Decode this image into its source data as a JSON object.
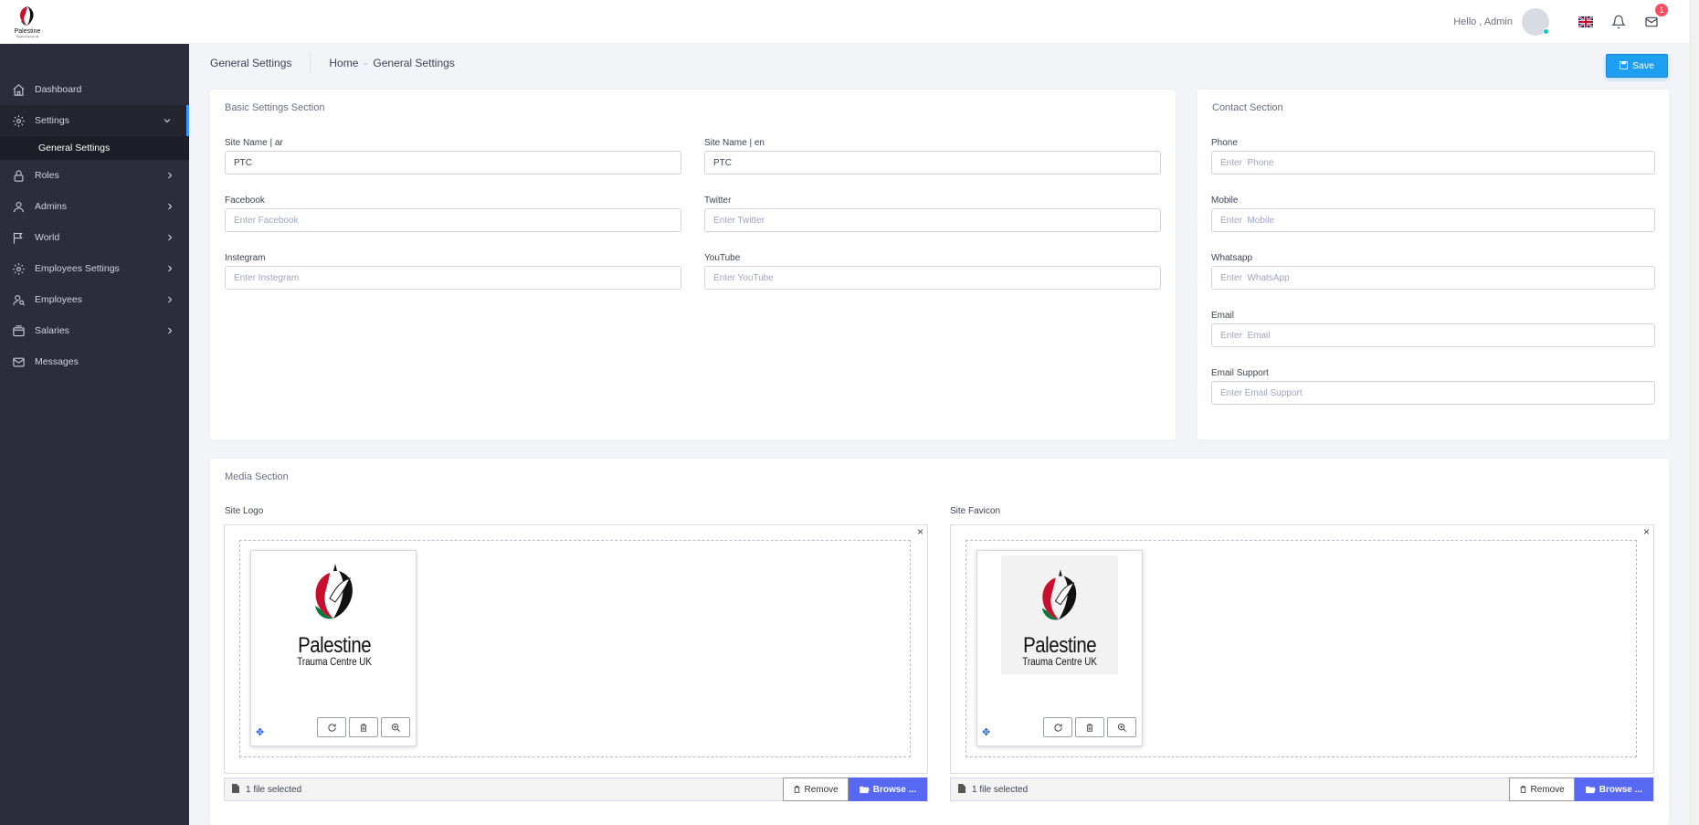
{
  "header": {
    "logo_text": "Palestine",
    "logo_sub": "Trauma Centre UK",
    "greeting": "Hello ,  Admin",
    "notifications_badge": "1"
  },
  "sidebar": {
    "items": [
      {
        "label": "Dashboard",
        "icon": "home-icon"
      },
      {
        "label": "Settings",
        "icon": "gear-icon"
      },
      {
        "label": "Roles",
        "icon": "lock-icon"
      },
      {
        "label": "Admins",
        "icon": "user-icon"
      },
      {
        "label": "World",
        "icon": "flag-icon"
      },
      {
        "label": "Employees Settings",
        "icon": "gear-icon"
      },
      {
        "label": "Employees",
        "icon": "users-icon"
      },
      {
        "label": "Salaries",
        "icon": "wallet-icon"
      },
      {
        "label": "Messages",
        "icon": "envelope-icon"
      }
    ],
    "sub_item": "General Settings"
  },
  "subheader": {
    "title": "General Settings",
    "crumb_home": "Home",
    "crumb_sep": "-",
    "crumb_current": "General Settings",
    "save_label": "Save"
  },
  "basic": {
    "title": "Basic Settings Section",
    "site_name_ar": {
      "label": "Site Name | ar",
      "value": "PTC",
      "placeholder": ""
    },
    "site_name_en": {
      "label": "Site Name | en",
      "value": "PTC",
      "placeholder": ""
    },
    "facebook": {
      "label": "Facebook",
      "value": "",
      "placeholder": "Enter Facebook"
    },
    "twitter": {
      "label": "Twitter",
      "value": "",
      "placeholder": "Enter Twitter"
    },
    "instagram": {
      "label": "Instegram",
      "value": "",
      "placeholder": "Enter Instegram"
    },
    "youtube": {
      "label": "YouTube",
      "value": "",
      "placeholder": "Enter YouTube"
    }
  },
  "contact": {
    "title": "Contact Section",
    "phone": {
      "label": "Phone",
      "placeholder": "Enter  Phone"
    },
    "mobile": {
      "label": "Mobile",
      "placeholder": "Enter  Mobile"
    },
    "whatsapp": {
      "label": "Whatsapp",
      "placeholder": "Enter  WhatsApp"
    },
    "email": {
      "label": "Email",
      "placeholder": "Enter  Email"
    },
    "email_support": {
      "label": "Email Support",
      "placeholder": "Enter Email Support"
    }
  },
  "media": {
    "title": "Media Section",
    "logo": {
      "label": "Site Logo",
      "caption": "1 file selected",
      "remove": "Remove",
      "browse": "Browse ..."
    },
    "favicon": {
      "label": "Site Favicon",
      "caption": "1 file selected",
      "remove": "Remove",
      "browse": "Browse ..."
    },
    "close_glyph": "×",
    "drag_glyph": "✥"
  },
  "colors": {
    "accent": "#1e9ff2",
    "sidebar_bg": "#2b2d3a",
    "browse_bg": "#5768f3",
    "badge": "#f64e60"
  }
}
